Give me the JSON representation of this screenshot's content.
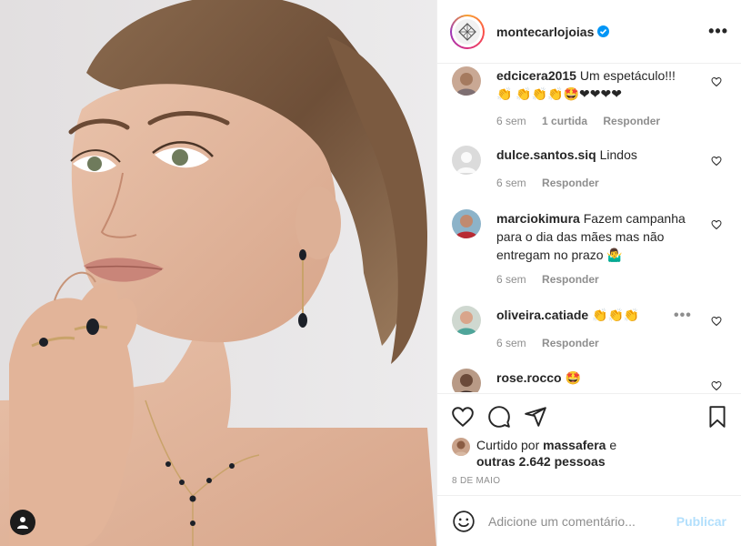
{
  "post": {
    "username": "montecarlojoias",
    "verified": true,
    "more_icon": "more-horizontal-icon"
  },
  "comments": [
    {
      "user": "edcicera2015",
      "text": "Um espetáculo!!!👏 👏👏👏🤩❤❤❤❤",
      "age": "6 sem",
      "likes": "1 curtida",
      "reply": "Responder"
    },
    {
      "user": "dulce.santos.siq",
      "text": "Lindos",
      "age": "6 sem",
      "reply": "Responder"
    },
    {
      "user": "marciokimura",
      "text": "Fazem campanha para o dia das mães mas não entregam no prazo 🤷‍♂️",
      "age": "6 sem",
      "reply": "Responder"
    },
    {
      "user": "oliveira.catiade",
      "text": "👏👏👏",
      "age": "6 sem",
      "reply": "Responder"
    },
    {
      "user": "rose.rocco",
      "text": "🤩"
    }
  ],
  "likes": {
    "prefix": "Curtido por",
    "user": "massafera",
    "connector": "e",
    "others": "outras 2.642 pessoas"
  },
  "date": "8 DE MAIO",
  "comment_box": {
    "placeholder": "Adicione um comentário...",
    "publish": "Publicar"
  },
  "colors": {
    "text": "#262626",
    "meta": "#8e8e8e",
    "verified": "#0095f6",
    "publish_disabled": "#b2dffc",
    "border": "#efefef"
  }
}
